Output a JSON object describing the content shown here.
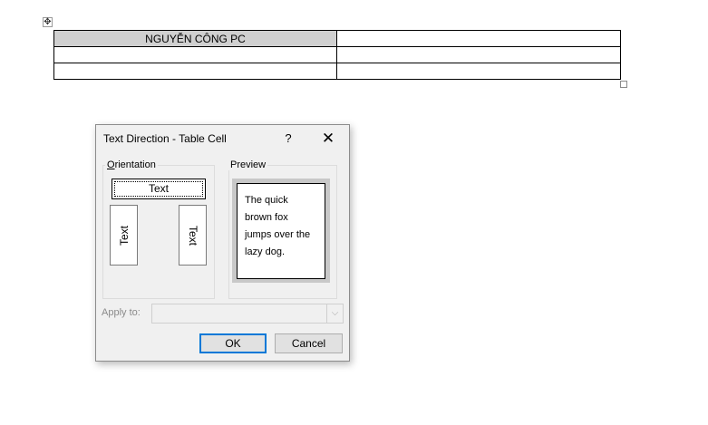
{
  "document": {
    "move_handle_icon": "move-arrows-icon",
    "table": {
      "rows": [
        [
          "NGUYỄN CÔNG PC",
          ""
        ],
        [
          "",
          ""
        ],
        [
          "",
          ""
        ]
      ],
      "shaded_cell_color": "#d0d0d0"
    }
  },
  "dialog": {
    "title": "Text Direction - Table Cell",
    "help_label": "?",
    "close_label": "✕",
    "orientation": {
      "label_accel": "O",
      "label_rest": "rientation",
      "options": [
        "Text",
        "Text",
        "Text"
      ],
      "selected_index": 0
    },
    "preview": {
      "label": "Preview",
      "lines": [
        "The quick",
        "brown fox",
        "jumps over the",
        "lazy dog."
      ]
    },
    "apply_to": {
      "label": "Apply to:",
      "value": "",
      "arrow": "⌵"
    },
    "buttons": {
      "ok": "OK",
      "cancel": "Cancel"
    },
    "accent_color": "#0078d7"
  }
}
